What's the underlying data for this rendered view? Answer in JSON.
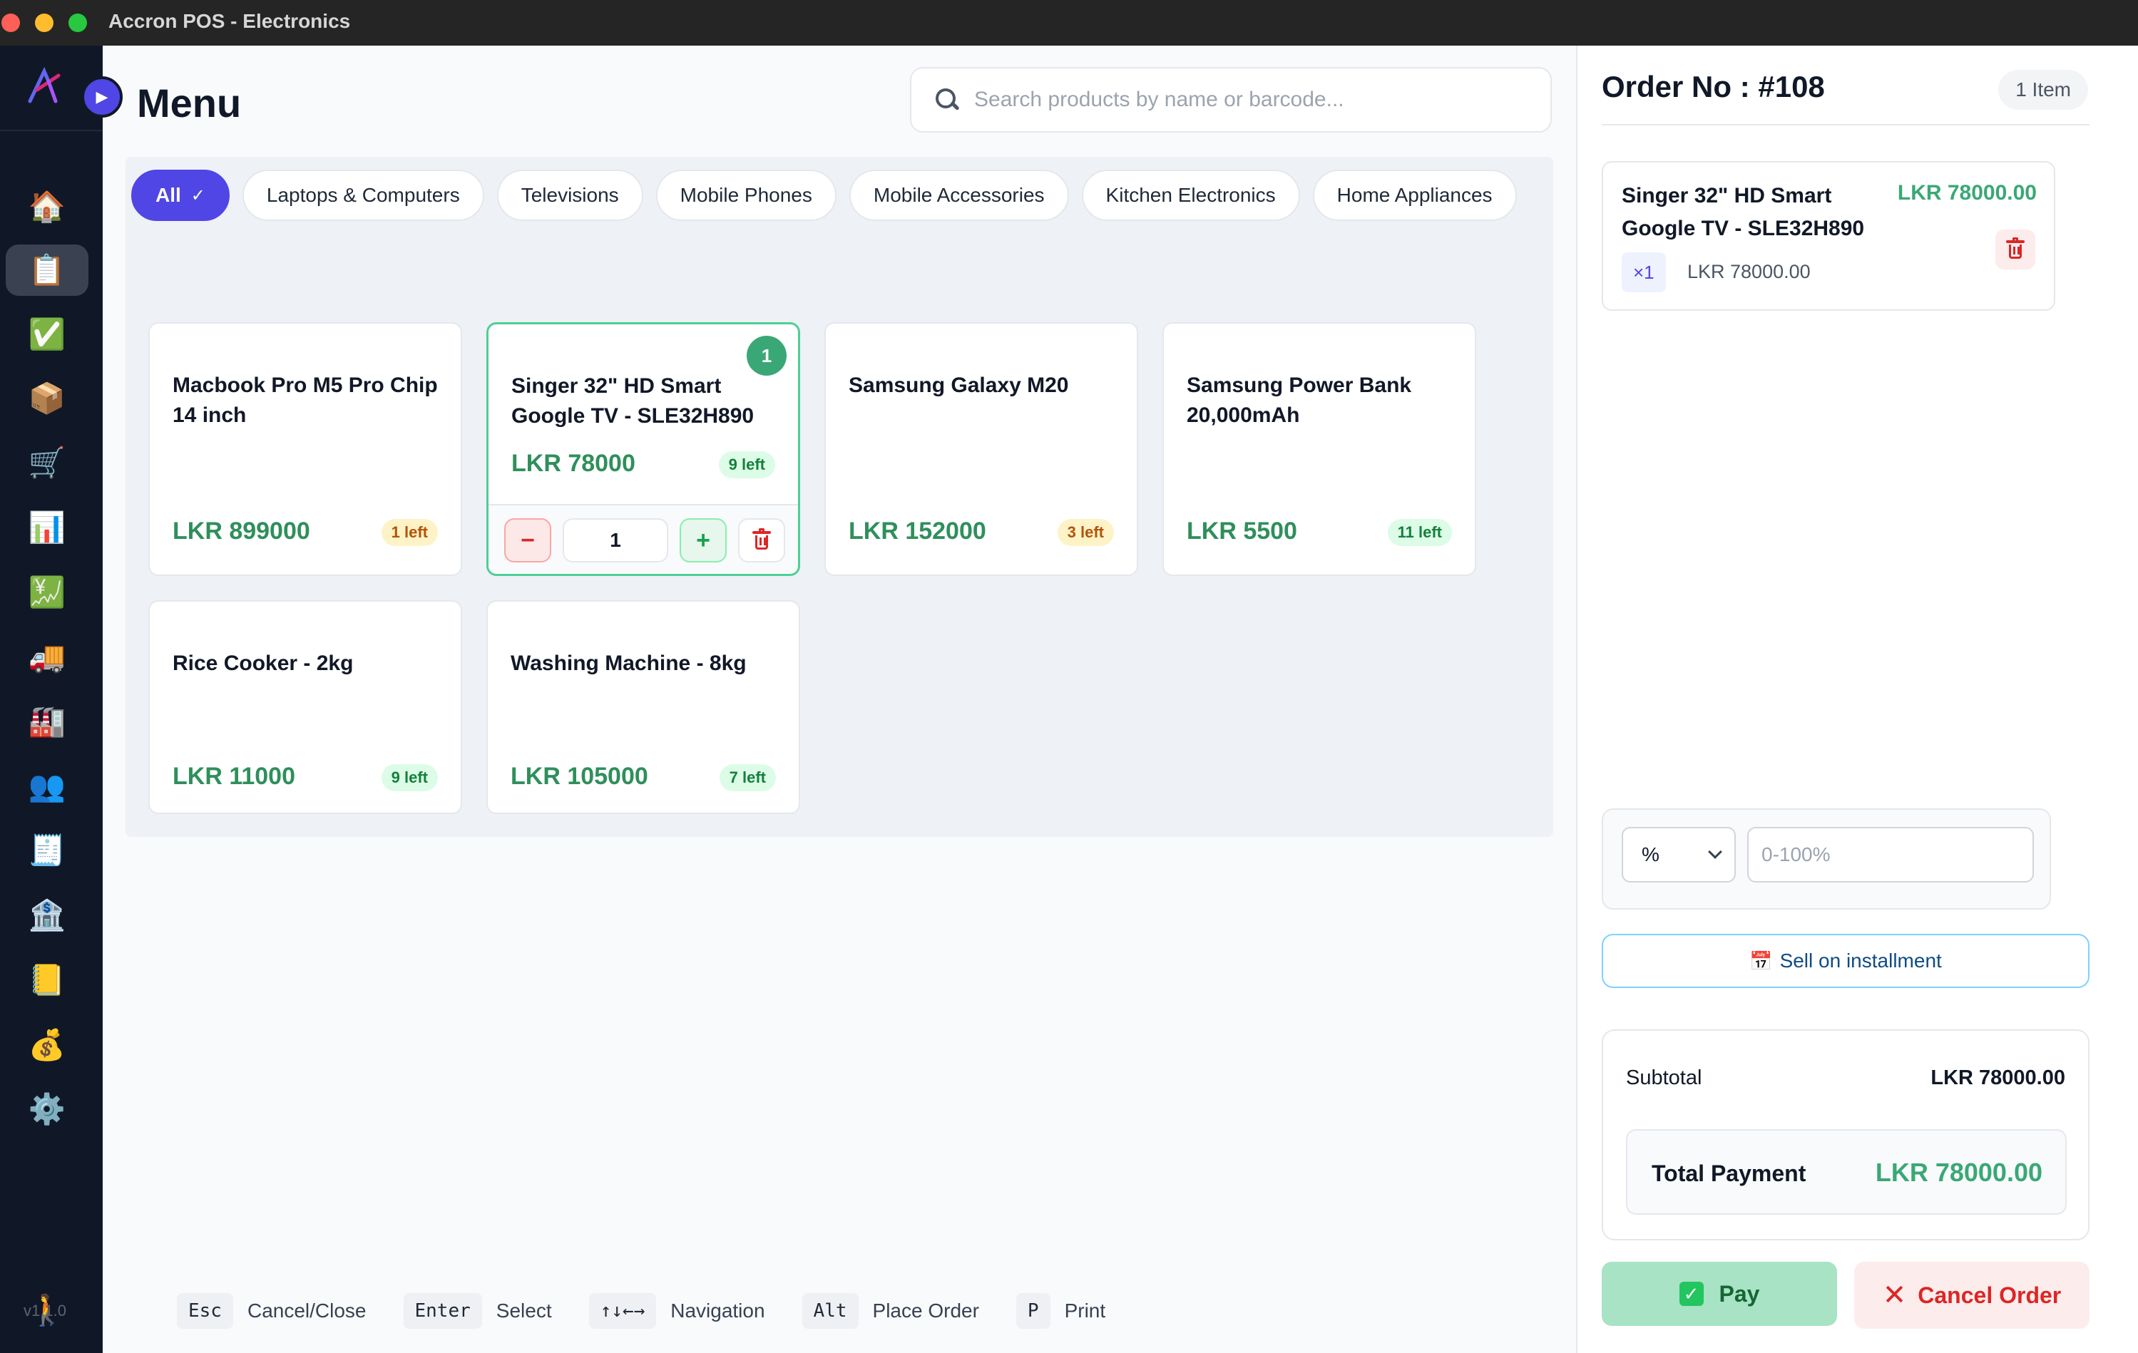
{
  "window": {
    "title": "Accron POS - Electronics"
  },
  "rail": {
    "items": [
      {
        "icon": "home-icon",
        "glyph": "🏠",
        "active": false
      },
      {
        "icon": "clipboard-icon",
        "glyph": "📋",
        "active": true
      },
      {
        "icon": "check-icon",
        "glyph": "✅",
        "active": false
      },
      {
        "icon": "package-icon",
        "glyph": "📦",
        "active": false
      },
      {
        "icon": "cart-icon",
        "glyph": "🛒",
        "active": false
      },
      {
        "icon": "bar-chart-icon",
        "glyph": "📊",
        "active": false
      },
      {
        "icon": "chart-yen-icon",
        "glyph": "💹",
        "active": false
      },
      {
        "icon": "truck-icon",
        "glyph": "🚚",
        "active": false
      },
      {
        "icon": "factory-icon",
        "glyph": "🏭",
        "active": false
      },
      {
        "icon": "users-icon",
        "glyph": "👥",
        "active": false
      },
      {
        "icon": "receipt-icon",
        "glyph": "🧾",
        "active": false
      },
      {
        "icon": "bank-icon",
        "glyph": "🏦",
        "active": false
      },
      {
        "icon": "notepad-icon",
        "glyph": "📒",
        "active": false
      },
      {
        "icon": "money-bag-icon",
        "glyph": "💰",
        "active": false
      },
      {
        "icon": "gear-icon",
        "glyph": "⚙️",
        "active": false
      }
    ],
    "user_glyph": "🚶",
    "version": "v1.1.0"
  },
  "main": {
    "title": "Menu",
    "search": {
      "placeholder": "Search products by name or barcode..."
    },
    "categories": [
      {
        "label": "All",
        "active": true
      },
      {
        "label": "Laptops & Computers",
        "active": false
      },
      {
        "label": "Televisions",
        "active": false
      },
      {
        "label": "Mobile Phones",
        "active": false
      },
      {
        "label": "Mobile Accessories",
        "active": false
      },
      {
        "label": "Kitchen Electronics",
        "active": false
      },
      {
        "label": "Home Appliances",
        "active": false
      }
    ],
    "products": [
      {
        "name": "Macbook Pro M5 Pro Chip 14 inch",
        "price": "LKR 899000",
        "stock": "1 left",
        "stock_level": "low"
      },
      {
        "name": "Singer 32\" HD Smart Google TV - SLE32H890",
        "price": "LKR 78000",
        "stock": "9 left",
        "stock_level": "ok",
        "in_cart_qty": "1",
        "selected": true
      },
      {
        "name": "Samsung Galaxy M20",
        "price": "LKR 152000",
        "stock": "3 left",
        "stock_level": "low"
      },
      {
        "name": "Samsung Power Bank 20,000mAh",
        "price": "LKR 5500",
        "stock": "11 left",
        "stock_level": "ok"
      },
      {
        "name": "Rice Cooker - 2kg",
        "price": "LKR 11000",
        "stock": "9 left",
        "stock_level": "ok"
      },
      {
        "name": "Washing Machine - 8kg",
        "price": "LKR 105000",
        "stock": "7 left",
        "stock_level": "ok"
      }
    ],
    "selected_controls": {
      "minus": "−",
      "qty": "1",
      "plus": "+"
    },
    "shortcuts": [
      {
        "key": "Esc",
        "label": "Cancel/Close"
      },
      {
        "key": "Enter",
        "label": "Select"
      },
      {
        "key": "↑↓←→",
        "label": "Navigation"
      },
      {
        "key": "Alt",
        "label": "Place Order"
      },
      {
        "key": "P",
        "label": "Print"
      }
    ]
  },
  "order": {
    "title": "Order No : #108",
    "items_count": "1 Item",
    "line_items": [
      {
        "name": "Singer 32\" HD Smart Google TV - SLE32H890",
        "line_total": "LKR 78000.00",
        "qty": "×1",
        "unit_price": "LKR 78000.00"
      }
    ],
    "discount": {
      "type": "%",
      "placeholder": "0-100%"
    },
    "installment_label": "Sell on installment",
    "subtotal_label": "Subtotal",
    "subtotal_value": "LKR 78000.00",
    "total_label": "Total Payment",
    "total_value": "LKR 78000.00",
    "pay_label": "Pay",
    "cancel_label": "Cancel Order"
  },
  "colors": {
    "accent": "#4f46e5",
    "price_green": "#2f8f5b",
    "danger": "#dc2626",
    "rail_bg": "#101827"
  }
}
